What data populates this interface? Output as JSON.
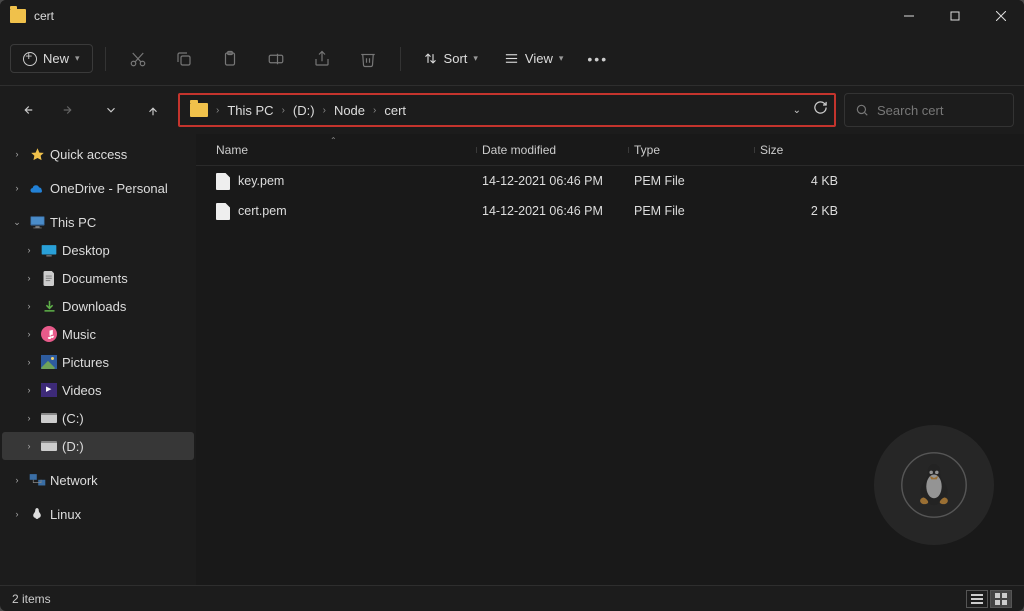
{
  "window": {
    "title": "cert"
  },
  "toolbar": {
    "new_label": "New",
    "sort_label": "Sort",
    "view_label": "View"
  },
  "breadcrumb": {
    "items": [
      "This PC",
      "(D:)",
      "Node",
      "cert"
    ]
  },
  "search": {
    "placeholder": "Search cert"
  },
  "sidebar": {
    "quick_access": "Quick access",
    "onedrive": "OneDrive - Personal",
    "this_pc": "This PC",
    "desktop": "Desktop",
    "documents": "Documents",
    "downloads": "Downloads",
    "music": "Music",
    "pictures": "Pictures",
    "videos": "Videos",
    "drive_c": "(C:)",
    "drive_d": "(D:)",
    "network": "Network",
    "linux": "Linux"
  },
  "columns": {
    "name": "Name",
    "date": "Date modified",
    "type": "Type",
    "size": "Size"
  },
  "files": [
    {
      "name": "key.pem",
      "date": "14-12-2021 06:46 PM",
      "type": "PEM File",
      "size": "4 KB"
    },
    {
      "name": "cert.pem",
      "date": "14-12-2021 06:46 PM",
      "type": "PEM File",
      "size": "2 KB"
    }
  ],
  "status": {
    "count": "2 items"
  }
}
